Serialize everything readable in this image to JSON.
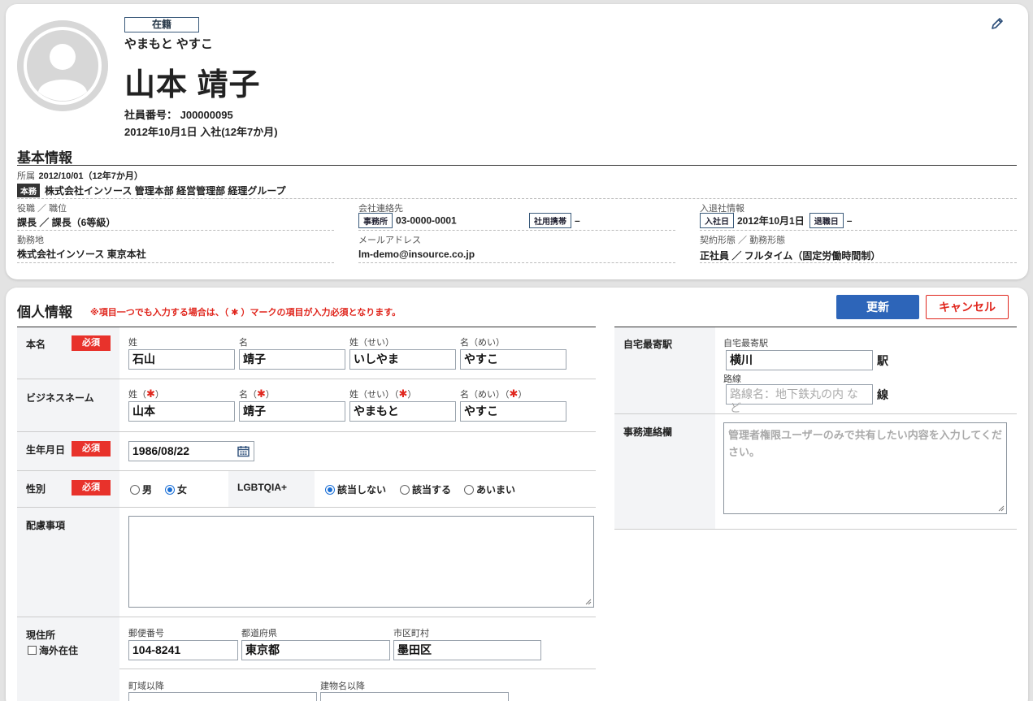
{
  "header": {
    "status": "在籍",
    "kana": "やまもと やすこ",
    "name": "山本 靖子",
    "employee_no": "社員番号： J00000095",
    "joined": "2012年10月1日 入社(12年7か月)"
  },
  "basic": {
    "title": "基本情報",
    "affiliation_label": "所属",
    "affiliation_date": "2012/10/01（12年7か月）",
    "affiliation_tag": "本務",
    "affiliation_value": "株式会社インソース 管理本部 経営管理部 経理グループ",
    "role_label": "役職 ／ 職位",
    "role_value": "課長 ／ 課長（6等級）",
    "workplace_label": "勤務地",
    "workplace_value": "株式会社インソース 東京本社",
    "contact_label": "会社連絡先",
    "office_tag": "事務所",
    "office_value": "03-0000-0001",
    "mobile_tag": "社用携帯",
    "mobile_value": "–",
    "mail_label": "メールアドレス",
    "mail_value": "lm-demo@insource.co.jp",
    "joinleave_label": "入退社情報",
    "join_tag": "入社日",
    "join_value": "2012年10月1日",
    "leave_tag": "退職日",
    "leave_value": "–",
    "contract_label": "契約形態 ／ 勤務形態",
    "contract_value": "正社員 ／ フルタイム（固定労働時間制）"
  },
  "personal": {
    "title": "個人情報",
    "note": "※項目一つでも入力する場合は、（ ✱ ）マークの項目が入力必須となります。",
    "update_label": "更新",
    "cancel_label": "キャンセル",
    "required_label": "必須",
    "real_name": {
      "label": "本名",
      "sei_label": "姓",
      "mei_label": "名",
      "sei_kana_label": "姓（せい）",
      "mei_kana_label": "名（めい）",
      "sei": "石山",
      "mei": "靖子",
      "sei_kana": "いしやま",
      "mei_kana": "やすこ"
    },
    "business_name": {
      "label": "ビジネスネーム",
      "sei_label": "姓（",
      "mei_label": "名（",
      "sei_kana_label": "姓（せい）（",
      "mei_kana_label": "名（めい）（",
      "star": "✱",
      "close": "）",
      "sei": "山本",
      "mei": "靖子",
      "sei_kana": "やまもと",
      "mei_kana": "やすこ"
    },
    "birthday": {
      "label": "生年月日",
      "value": "1986/08/22"
    },
    "gender": {
      "label": "性別",
      "male": "男",
      "female": "女",
      "selected": "女"
    },
    "lgbt": {
      "label": "LGBTQIA+",
      "opt1": "該当しない",
      "opt2": "該当する",
      "opt3": "あいまい",
      "selected": "該当しない"
    },
    "consideration": {
      "label": "配慮事項",
      "value": ""
    },
    "address": {
      "label": "現住所",
      "overseas": "海外在住",
      "postal_label": "郵便番号",
      "postal": "104-8241",
      "pref_label": "都道府県",
      "pref": "東京都",
      "city_label": "市区町村",
      "city": "墨田区",
      "street_label": "町域以降",
      "building_label": "建物名以降"
    },
    "station": {
      "label": "自宅最寄駅",
      "field_label": "自宅最寄駅",
      "value": "横川",
      "suffix": "駅",
      "line_label": "路線",
      "line_placeholder": "路線名：地下鉄丸の内 など",
      "line_suffix": "線"
    },
    "office_note": {
      "label": "事務連絡欄",
      "placeholder": "管理者権限ユーザーのみで共有したい内容を入力してください。"
    }
  },
  "colors": {
    "accent": "#2d65b9",
    "danger": "#e0261d",
    "required_bg": "#e8322b"
  }
}
